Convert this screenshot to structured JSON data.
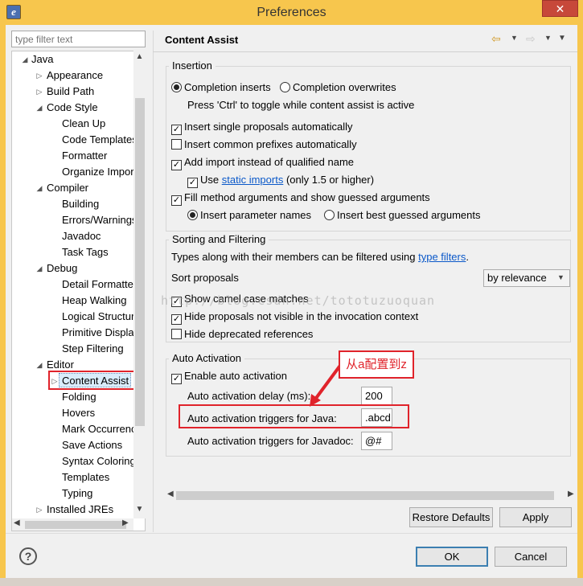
{
  "window": {
    "title": "Preferences",
    "close_glyph": "✕",
    "app_icon": "eclipse-icon"
  },
  "filter": {
    "placeholder": "type filter text"
  },
  "tree": {
    "nodes": [
      {
        "label": "Java",
        "twisty": "◢"
      },
      {
        "label": "Appearance",
        "twisty": "▷"
      },
      {
        "label": "Build Path",
        "twisty": "▷"
      },
      {
        "label": "Code Style",
        "twisty": "◢"
      },
      {
        "label": "Clean Up",
        "twisty": ""
      },
      {
        "label": "Code Templates",
        "twisty": ""
      },
      {
        "label": "Formatter",
        "twisty": ""
      },
      {
        "label": "Organize Imports",
        "twisty": ""
      },
      {
        "label": "Compiler",
        "twisty": "◢"
      },
      {
        "label": "Building",
        "twisty": ""
      },
      {
        "label": "Errors/Warnings",
        "twisty": ""
      },
      {
        "label": "Javadoc",
        "twisty": ""
      },
      {
        "label": "Task Tags",
        "twisty": ""
      },
      {
        "label": "Debug",
        "twisty": "◢"
      },
      {
        "label": "Detail Formatters",
        "twisty": ""
      },
      {
        "label": "Heap Walking",
        "twisty": ""
      },
      {
        "label": "Logical Structures",
        "twisty": ""
      },
      {
        "label": "Primitive Display",
        "twisty": ""
      },
      {
        "label": "Step Filtering",
        "twisty": ""
      },
      {
        "label": "Editor",
        "twisty": "◢"
      },
      {
        "label": "Content Assist",
        "twisty": "▷"
      },
      {
        "label": "Folding",
        "twisty": ""
      },
      {
        "label": "Hovers",
        "twisty": ""
      },
      {
        "label": "Mark Occurrences",
        "twisty": ""
      },
      {
        "label": "Save Actions",
        "twisty": ""
      },
      {
        "label": "Syntax Coloring",
        "twisty": ""
      },
      {
        "label": "Templates",
        "twisty": ""
      },
      {
        "label": "Typing",
        "twisty": ""
      },
      {
        "label": "Installed JREs",
        "twisty": "▷"
      }
    ],
    "selected": "Content Assist"
  },
  "page": {
    "title": "Content Assist"
  },
  "insertion": {
    "legend": "Insertion",
    "completion_inserts": "Completion inserts",
    "completion_overwrites": "Completion overwrites",
    "toggle_hint": "Press 'Ctrl' to toggle while content assist is active",
    "single_proposals": "Insert single proposals automatically",
    "common_prefixes": "Insert common prefixes automatically",
    "add_import": "Add import instead of qualified name",
    "use_prefix": "Use",
    "static_imports": "static imports",
    "use_suffix": "(only 1.5 or higher)",
    "fill_args": "Fill method arguments and show guessed arguments",
    "insert_param_names": "Insert parameter names",
    "insert_best_guessed": "Insert best guessed arguments"
  },
  "sorting": {
    "legend": "Sorting and Filtering",
    "types_prefix": "Types along with their members can be filtered using",
    "type_filters": "type filters",
    "types_suffix": ".",
    "sort_label": "Sort proposals",
    "sort_value": "by relevance",
    "camel_case": "Show camel case matches",
    "hide_not_visible": "Hide proposals not visible in the invocation context",
    "hide_deprecated": "Hide deprecated references"
  },
  "auto_activation": {
    "legend": "Auto Activation",
    "enable": "Enable auto activation",
    "delay_label": "Auto activation delay (ms):",
    "delay_value": "200",
    "java_triggers_label": "Auto activation triggers for Java:",
    "java_triggers_value": ".abcd",
    "javadoc_triggers_label": "Auto activation triggers for Javadoc:",
    "javadoc_triggers_value": "@#"
  },
  "annotation": {
    "text": "从a配置到z"
  },
  "watermark": "http://blog.csdn.net/tototuzuoquan",
  "buttons": {
    "restore_defaults": "Restore Defaults",
    "apply": "Apply",
    "ok": "OK",
    "cancel": "Cancel",
    "help": "?"
  },
  "colors": {
    "titlebar": "#f7c64d",
    "highlight": "#e0232b",
    "link": "#0a58c9"
  }
}
